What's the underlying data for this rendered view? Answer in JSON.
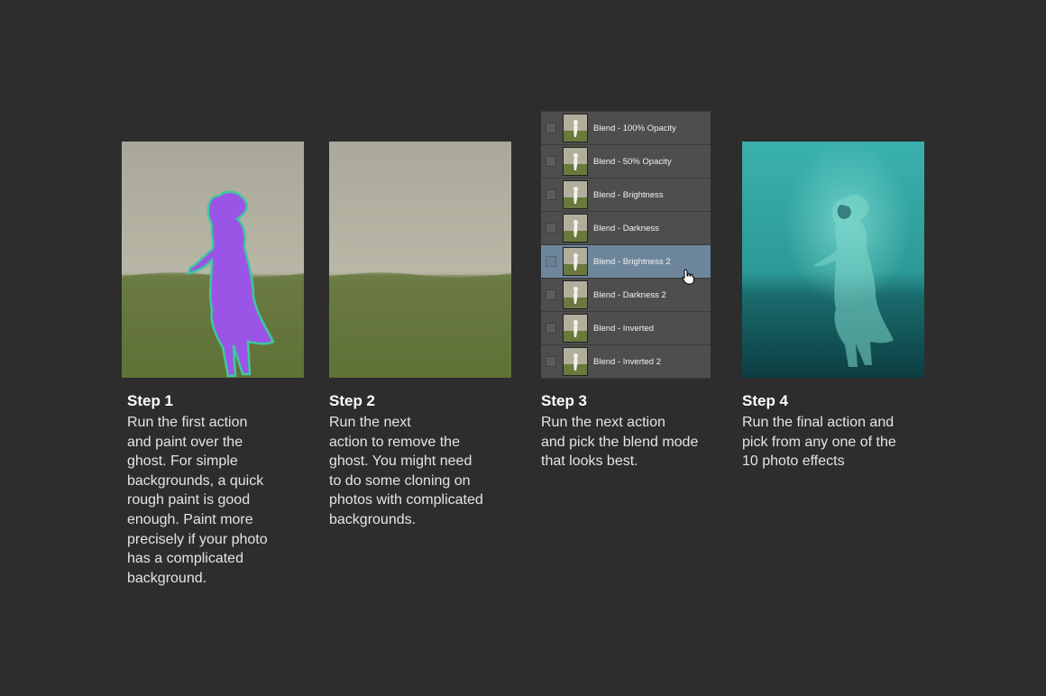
{
  "steps": [
    {
      "title": "Step 1",
      "lines": [
        "Run the first action",
        "and paint over the",
        "ghost. For simple",
        "backgrounds, a quick",
        "rough paint is good",
        "enough. Paint more",
        "precisely if your photo",
        "has a complicated",
        "background."
      ]
    },
    {
      "title": "Step 2",
      "lines": [
        "Run the next",
        "action to remove the",
        "ghost. You might need",
        "to do some cloning on",
        "photos with complicated",
        "backgrounds."
      ]
    },
    {
      "title": "Step 3",
      "lines": [
        "Run the next action",
        "and pick the blend mode",
        "that looks best."
      ]
    },
    {
      "title": "Step 4",
      "lines": [
        "Run the final action and",
        "pick from any one of the",
        "10 photo effects"
      ]
    }
  ],
  "layers_panel": {
    "items": [
      {
        "label": "Blend - 100% Opacity"
      },
      {
        "label": "Blend - 50% Opacity"
      },
      {
        "label": "Blend - Brightness"
      },
      {
        "label": "Blend - Darkness"
      },
      {
        "label": "Blend - Brightness 2",
        "selected": true
      },
      {
        "label": "Blend - Darkness 2"
      },
      {
        "label": "Blend - Inverted"
      },
      {
        "label": "Blend - Inverted 2"
      }
    ],
    "cursor_icon": "hand-pointer-icon"
  },
  "colors": {
    "background": "#2d2d2d",
    "mask_purple": "#9a55e6",
    "mask_outline": "#3ec8a0",
    "teal_effect": "#2fa3a0",
    "selected_row": "#6e869c"
  }
}
